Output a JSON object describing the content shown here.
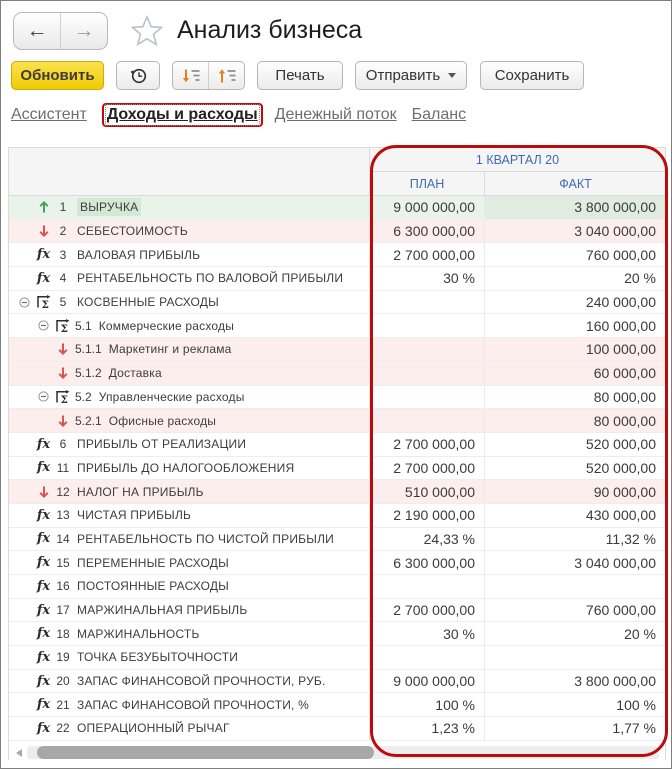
{
  "window": {
    "title": "Анализ бизнеса"
  },
  "toolbar": {
    "refresh_label": "Обновить",
    "print_label": "Печать",
    "send_label": "Отправить",
    "save_label": "Сохранить",
    "icons": [
      "back-arrow-icon",
      "forward-arrow-icon",
      "star-icon",
      "history-clock-icon",
      "expand-levels-icon",
      "collapse-levels-icon",
      "dropdown-caret-icon"
    ]
  },
  "tabs": [
    {
      "label": "Ассистент",
      "active": false
    },
    {
      "label": "Доходы и расходы",
      "active": true
    },
    {
      "label": "Денежный поток",
      "active": false
    },
    {
      "label": "Баланс",
      "active": false
    }
  ],
  "table": {
    "period_header": "1 КВАРТАЛ 20",
    "columns": {
      "plan": "ПЛАН",
      "fact": "ФАКТ"
    },
    "rows": [
      {
        "num": "1",
        "label": "ВЫРУЧКА",
        "icon": "up",
        "tone": "green",
        "level": 0,
        "focus": true,
        "plan": "9 000 000,00",
        "fact": "3 800 000,00"
      },
      {
        "num": "2",
        "label": "СЕБЕСТОИМОСТЬ",
        "icon": "down",
        "tone": "pink",
        "level": 0,
        "plan": "6 300 000,00",
        "fact": "3 040 000,00"
      },
      {
        "num": "3",
        "label": "ВАЛОВАЯ ПРИБЫЛЬ",
        "icon": "fx",
        "level": 0,
        "plan": "2 700 000,00",
        "fact": "760 000,00"
      },
      {
        "num": "4",
        "label": "РЕНТАБЕЛЬНОСТЬ ПО ВАЛОВОЙ ПРИБЫЛИ",
        "icon": "fx",
        "level": 0,
        "plan": "30 %",
        "fact": "20 %"
      },
      {
        "num": "5",
        "label": "КОСВЕННЫЕ РАСХОДЫ",
        "icon": "group",
        "expander": true,
        "level": 0,
        "plan": "",
        "fact": "240 000,00"
      },
      {
        "num": "5.1",
        "label": "Коммерческие расходы",
        "icon": "group",
        "expander": true,
        "level": 1,
        "plan": "",
        "fact": "160 000,00"
      },
      {
        "num": "5.1.1",
        "label": "Маркетинг и реклама",
        "icon": "down",
        "tone": "pink",
        "level": 2,
        "plan": "",
        "fact": "100 000,00"
      },
      {
        "num": "5.1.2",
        "label": "Доставка",
        "icon": "down",
        "tone": "pink",
        "level": 2,
        "plan": "",
        "fact": "60 000,00"
      },
      {
        "num": "5.2",
        "label": "Управленческие расходы",
        "icon": "group",
        "expander": true,
        "level": 1,
        "plan": "",
        "fact": "80 000,00"
      },
      {
        "num": "5.2.1",
        "label": "Офисные расходы",
        "icon": "down",
        "tone": "pink",
        "level": 2,
        "plan": "",
        "fact": "80 000,00"
      },
      {
        "num": "6",
        "label": "ПРИБЫЛЬ ОТ РЕАЛИЗАЦИИ",
        "icon": "fx",
        "level": 0,
        "plan": "2 700 000,00",
        "fact": "520 000,00"
      },
      {
        "num": "11",
        "label": "ПРИБЫЛЬ ДО НАЛОГООБЛОЖЕНИЯ",
        "icon": "fx",
        "level": 0,
        "plan": "2 700 000,00",
        "fact": "520 000,00"
      },
      {
        "num": "12",
        "label": "НАЛОГ НА ПРИБЫЛЬ",
        "icon": "down",
        "tone": "pink",
        "level": 0,
        "plan": "510 000,00",
        "fact": "90 000,00"
      },
      {
        "num": "13",
        "label": "ЧИСТАЯ ПРИБЫЛЬ",
        "icon": "fx",
        "level": 0,
        "plan": "2 190 000,00",
        "fact": "430 000,00"
      },
      {
        "num": "14",
        "label": "РЕНТАБЕЛЬНОСТЬ ПО ЧИСТОЙ ПРИБЫЛИ",
        "icon": "fx",
        "level": 0,
        "plan": "24,33 %",
        "fact": "11,32 %"
      },
      {
        "num": "15",
        "label": "ПЕРЕМЕННЫЕ РАСХОДЫ",
        "icon": "fx",
        "level": 0,
        "plan": "6 300 000,00",
        "fact": "3 040 000,00"
      },
      {
        "num": "16",
        "label": "ПОСТОЯННЫЕ РАСХОДЫ",
        "icon": "fx",
        "level": 0,
        "plan": "",
        "fact": ""
      },
      {
        "num": "17",
        "label": "МАРЖИНАЛЬНАЯ ПРИБЫЛЬ",
        "icon": "fx",
        "level": 0,
        "plan": "2 700 000,00",
        "fact": "760 000,00"
      },
      {
        "num": "18",
        "label": "МАРЖИНАЛЬНОСТЬ",
        "icon": "fx",
        "level": 0,
        "plan": "30 %",
        "fact": "20 %"
      },
      {
        "num": "19",
        "label": "ТОЧКА БЕЗУБЫТОЧНОСТИ",
        "icon": "fx",
        "level": 0,
        "plan": "",
        "fact": ""
      },
      {
        "num": "20",
        "label": "ЗАПАС ФИНАНСОВОЙ ПРОЧНОСТИ, РУБ.",
        "icon": "fx",
        "level": 0,
        "plan": "9 000 000,00",
        "fact": "3 800 000,00"
      },
      {
        "num": "21",
        "label": "ЗАПАС ФИНАНСОВОЙ ПРОЧНОСТИ, %",
        "icon": "fx",
        "level": 0,
        "plan": "100 %",
        "fact": "100 %"
      },
      {
        "num": "22",
        "label": "ОПЕРАЦИОННЫЙ РЫЧАГ",
        "icon": "fx",
        "level": 0,
        "plan": "1,23 %",
        "fact": "1,77 %"
      }
    ]
  },
  "colors": {
    "accent_yellow": "#f0ca05",
    "annotation_red": "#ba0c0c",
    "header_blue": "#3d6cb5",
    "positive_green": "#3fa45f",
    "negative_red": "#d9534f",
    "row_green_bg": "#e9f3e9",
    "row_pink_bg": "#fdeeee"
  }
}
